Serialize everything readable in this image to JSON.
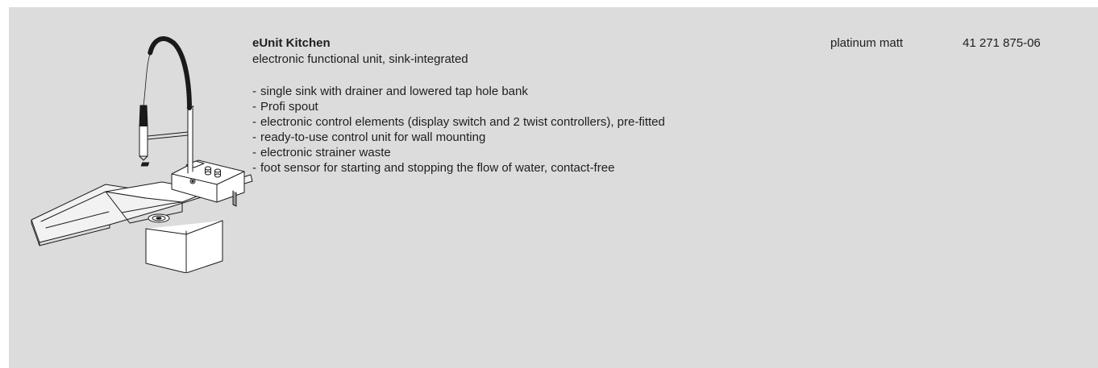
{
  "product": {
    "title": "eUnit Kitchen",
    "subtitle": "electronic functional unit, sink-integrated",
    "features": [
      "single sink with drainer and lowered tap hole bank",
      "Profi spout",
      "electronic control elements (display switch and 2 twist controllers), pre-fitted",
      "ready-to-use control unit for wall mounting",
      "electronic strainer waste",
      "foot sensor for starting and stopping the flow of water, contact-free"
    ],
    "finish": "platinum matt",
    "article_number": "41 271 875-06"
  },
  "image": {
    "icon": "kitchen-sink-with-profi-spout-illustration"
  },
  "colors": {
    "panel_background": "#dcdcdc",
    "text": "#1e1e1e",
    "drawing_stroke": "#1a1a1a"
  }
}
